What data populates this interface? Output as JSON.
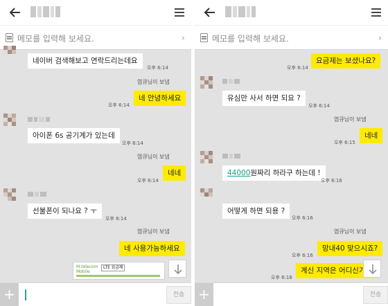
{
  "left": {
    "memo_placeholder": "메모를 입력해 보세요.",
    "input_placeholder": "",
    "send_label": "전송",
    "messages": [
      {
        "dir": "in",
        "text": "네이버 검색해보고 연락드리는데요",
        "time": "오후 6:14"
      },
      {
        "dir": "out",
        "sender": "염큐님이 보냄",
        "text": "네 안녕하세요",
        "time": "오후 6:14"
      },
      {
        "dir": "in",
        "text": "아이폰 6s 공기계가 있는데",
        "time": "오후 6:14"
      },
      {
        "dir": "out",
        "sender": "염큐님이 보냄",
        "text": "네네",
        "time": "오후 6:14"
      },
      {
        "dir": "in",
        "text": "선불폰이 되나요 ? ㅜ",
        "time": "오후 6:14"
      },
      {
        "dir": "out",
        "sender": "염큐님이 보냄",
        "text": "네 사용가능하세요"
      }
    ],
    "card": {
      "logo_line1": "M telecom",
      "logo_line2": "Mobile",
      "label": "LTE 요금제"
    }
  },
  "right": {
    "memo_placeholder": "메모를 입력해 보세요.",
    "input_placeholder": "",
    "send_label": "전송",
    "messages": [
      {
        "dir": "out",
        "text": "요금제는 보셨나요?",
        "time": "오후 6:14"
      },
      {
        "dir": "in",
        "text": "유심만 사서 하면 되요 ?",
        "time": "오후 6:14"
      },
      {
        "dir": "out",
        "sender": "염큐님이 보냄",
        "text": "네네",
        "time": "오후 6:15"
      },
      {
        "dir": "in",
        "text_link": "44000",
        "text_rest": "원짜리 하라구 하는데 !",
        "time": "오후 6:16"
      },
      {
        "dir": "in",
        "text": "어떻게 하면 되용 ?",
        "time": "오후 6:16"
      },
      {
        "dir": "out",
        "sender": "염큐님이 보냄",
        "text": "망내40 맞으시죠?",
        "time": "오후 6:16"
      },
      {
        "dir": "out",
        "text": "계신 지역은 어디신가",
        "time": "오후 6:16"
      }
    ]
  },
  "colors": {
    "bubble_out": "#ffeb00",
    "bubble_in": "#ffffff",
    "chat_bg": "#e2e2e2",
    "link": "#16a085"
  },
  "icons": [
    "back-arrow-icon",
    "menu-icon",
    "memo-icon",
    "chevron-right-icon",
    "plus-icon",
    "scroll-down-icon"
  ]
}
